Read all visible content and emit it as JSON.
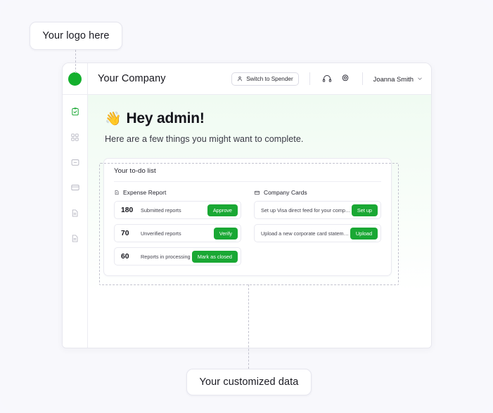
{
  "annotations": {
    "logo_callout": "Your logo here",
    "data_callout": "Your customized data"
  },
  "colors": {
    "brand_green": "#14b02e",
    "button_green": "#1aa834",
    "page_background": "#f8f8fc",
    "dashed_guide": "#c3c3cf"
  },
  "topbar": {
    "logo_icon": "green-circle-logo",
    "company_name": "Your Company",
    "switch_button": {
      "label": "Switch to Spender",
      "icon": "person-icon"
    },
    "support_icon": "headset-icon",
    "settings_icon": "gear-icon",
    "user": {
      "name": "Joanna Smith",
      "chevron_icon": "chevron-down-icon"
    }
  },
  "sidebar": {
    "items": [
      {
        "name": "tasks",
        "icon": "clipboard-check-icon",
        "active": true
      },
      {
        "name": "dashboard",
        "icon": "grid-icon",
        "active": false
      },
      {
        "name": "folders",
        "icon": "folder-icon",
        "active": false
      },
      {
        "name": "cards",
        "icon": "card-icon",
        "active": false
      },
      {
        "name": "reports",
        "icon": "document-icon",
        "active": false
      },
      {
        "name": "statements",
        "icon": "document-icon",
        "active": false
      }
    ]
  },
  "greeting": {
    "emoji": "👋",
    "title": "Hey admin!",
    "subtitle": "Here are a few things you might want to complete."
  },
  "todo": {
    "title": "Your to-do list",
    "columns": [
      {
        "heading": "Expense Report",
        "icon": "document-icon",
        "tasks": [
          {
            "count": "180",
            "label": "Submitted reports",
            "action": "Approve"
          },
          {
            "count": "70",
            "label": "Unverified reports",
            "action": "Verify"
          },
          {
            "count": "60",
            "label": "Reports in processing",
            "action": "Mark as closed"
          }
        ]
      },
      {
        "heading": "Company Cards",
        "icon": "card-icon",
        "tasks": [
          {
            "count": "",
            "label": "Set up Visa direct feed for your company",
            "action": "Set up"
          },
          {
            "count": "",
            "label": "Upload a new corporate card statement",
            "action": "Upload"
          }
        ]
      }
    ]
  }
}
